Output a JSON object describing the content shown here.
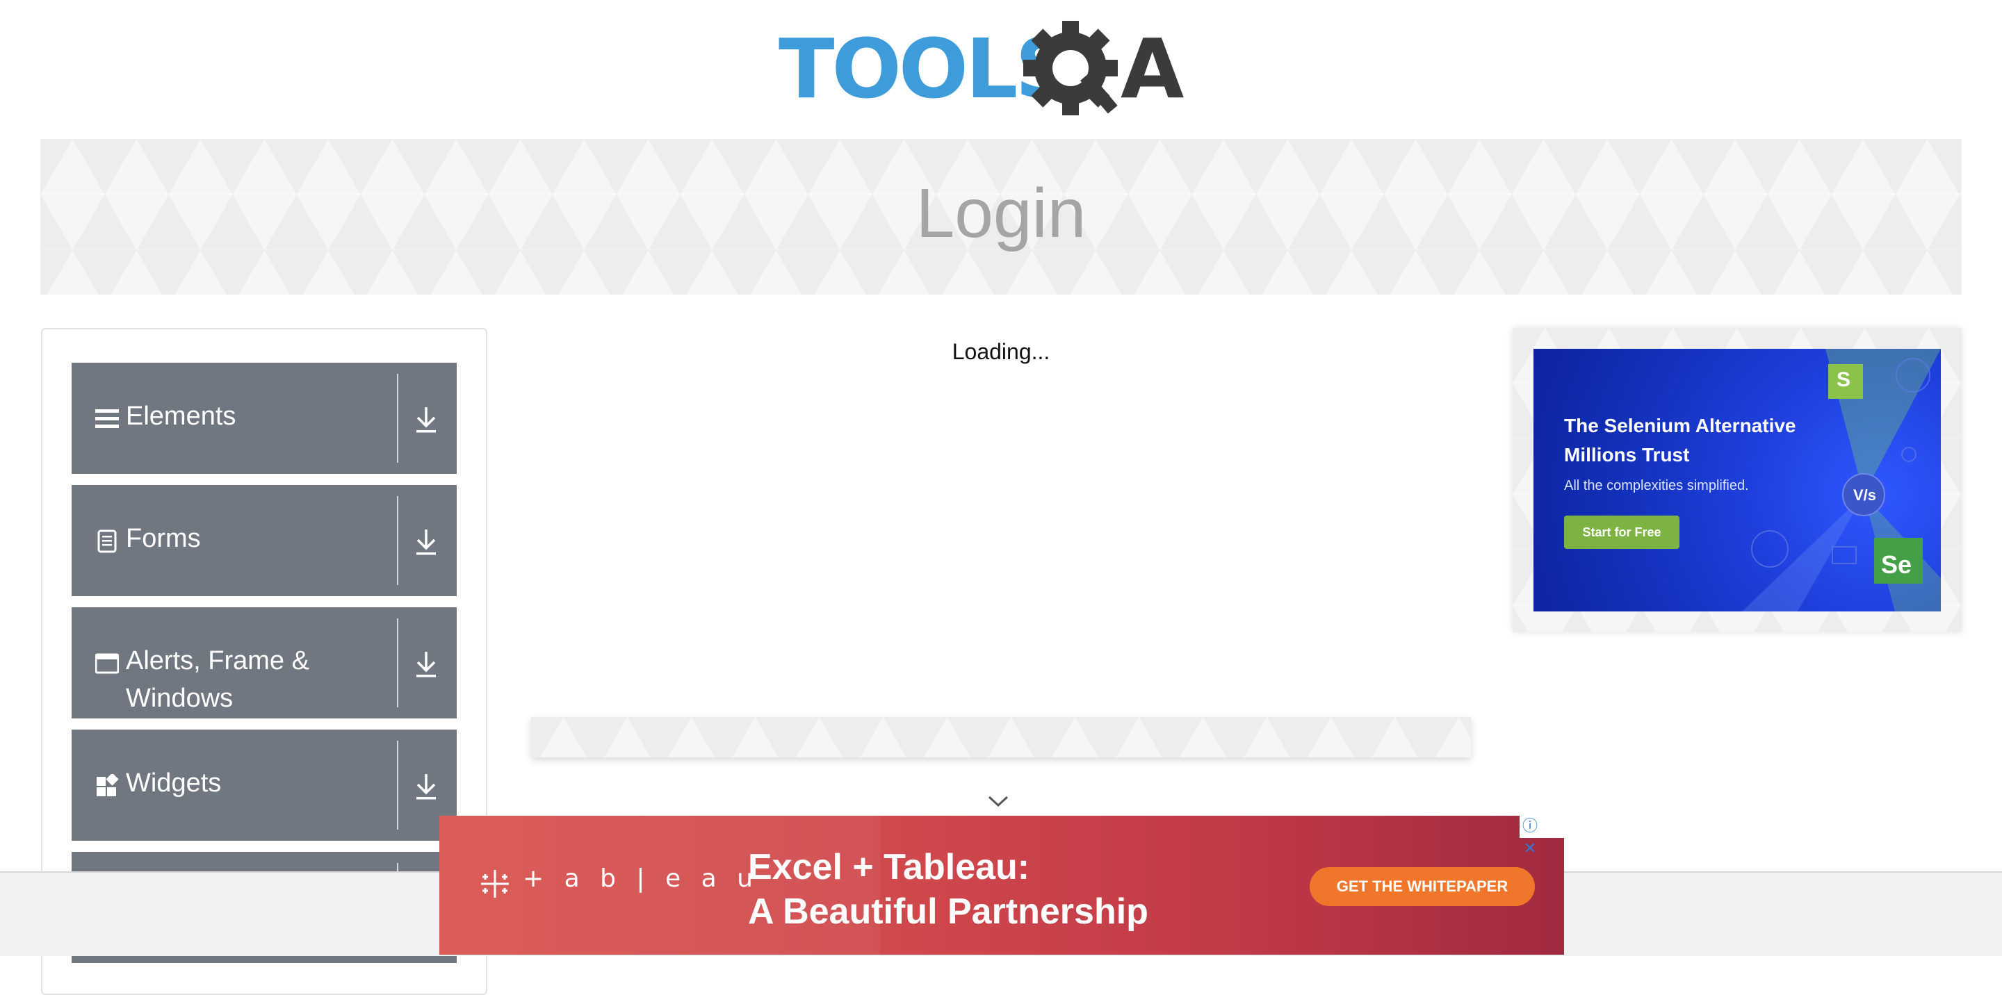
{
  "logo": {
    "text": "TOOLSQA",
    "brand_blue": "#3f9cdb",
    "gear_color": "#3b3b3b"
  },
  "banner": {
    "title": "Login"
  },
  "sidebar": {
    "groups": [
      {
        "label": "Elements",
        "icon": "hamburger-icon"
      },
      {
        "label": "Forms",
        "icon": "document-icon"
      },
      {
        "label": "Alerts, Frame & Windows",
        "icon": "window-icon"
      },
      {
        "label": "Widgets",
        "icon": "widgets-icon"
      }
    ],
    "group_color": "#707780"
  },
  "main": {
    "loading_text": "Loading..."
  },
  "right_ad": {
    "headline": "The Selenium Alternative Millions Trust",
    "subtext": "All the complexities simplified.",
    "cta": "Start for Free",
    "vs_text": "V/s",
    "logo_s": "S",
    "logo_se": "Se"
  },
  "bottom_ad": {
    "brand": "+ a b | e a u",
    "headline_line1": "Excel + Tableau:",
    "headline_line2": "A Beautiful Partnership",
    "cta": "GET THE WHITEPAPER",
    "info": "ⓘ",
    "close": "✕"
  }
}
